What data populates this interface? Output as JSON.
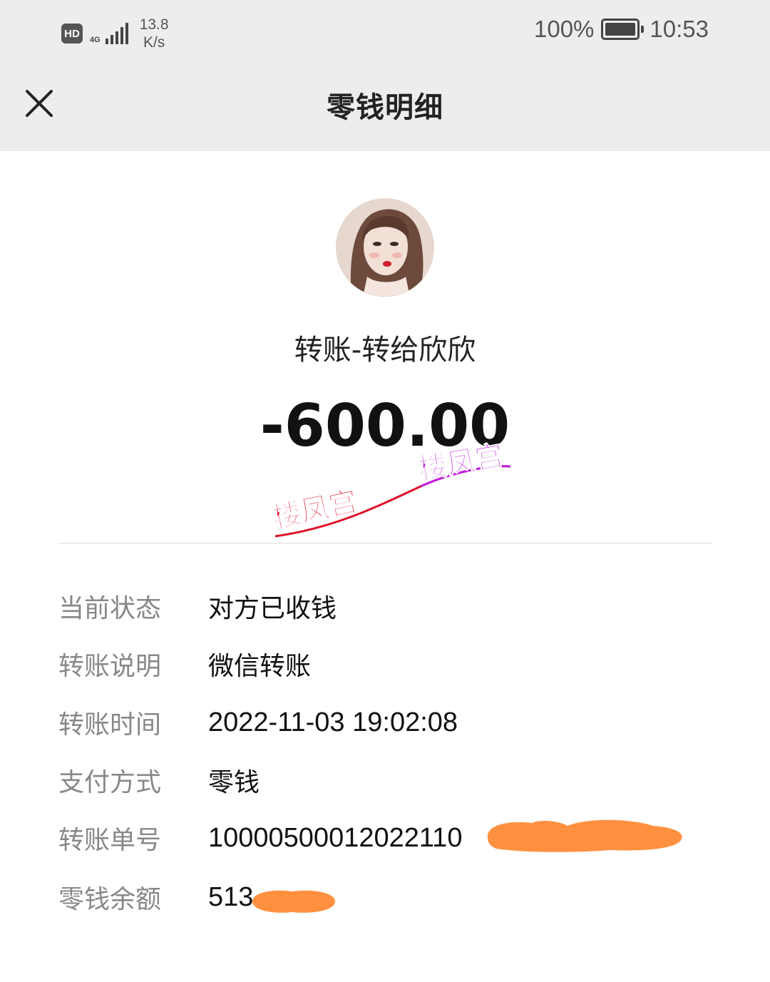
{
  "status_bar": {
    "hd": "HD",
    "network": "4G",
    "speed_value": "13.8",
    "speed_unit": "K/s",
    "battery": "100%",
    "time": "10:53"
  },
  "nav": {
    "title": "零钱明细"
  },
  "transfer": {
    "payee": "转账-转给欣欣",
    "amount": "-600.00",
    "watermark": [
      "楼凤宫",
      "楼凤宫"
    ]
  },
  "details": [
    {
      "label": "当前状态",
      "value": "对方已收钱"
    },
    {
      "label": "转账说明",
      "value": "微信转账"
    },
    {
      "label": "转账时间",
      "value": "2022-11-03 19:02:08"
    },
    {
      "label": "支付方式",
      "value": "零钱"
    },
    {
      "label": "转账单号",
      "value": "10000500012022110"
    },
    {
      "label": "零钱余额",
      "value": "513"
    }
  ],
  "colors": {
    "bar_bg": "#ededed",
    "redaction": "#ff9040",
    "watermark_red": "#e0102a",
    "watermark_purple": "#c020e0"
  }
}
